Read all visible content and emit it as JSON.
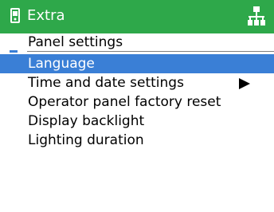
{
  "header": {
    "title": "Extra",
    "left_icon": "device-icon",
    "right_icon": "network-icon",
    "background": "#2ea84a"
  },
  "subheader": {
    "title": "Panel settings"
  },
  "menu": {
    "selected_color": "#3a7fd6",
    "items": [
      {
        "label": "Language",
        "selected": true,
        "has_submenu": false
      },
      {
        "label": "Time and date settings",
        "selected": false,
        "has_submenu": true
      },
      {
        "label": "Operator panel factory reset",
        "selected": false,
        "has_submenu": false
      },
      {
        "label": "Display backlight",
        "selected": false,
        "has_submenu": false
      },
      {
        "label": "Lighting duration",
        "selected": false,
        "has_submenu": false
      }
    ]
  }
}
